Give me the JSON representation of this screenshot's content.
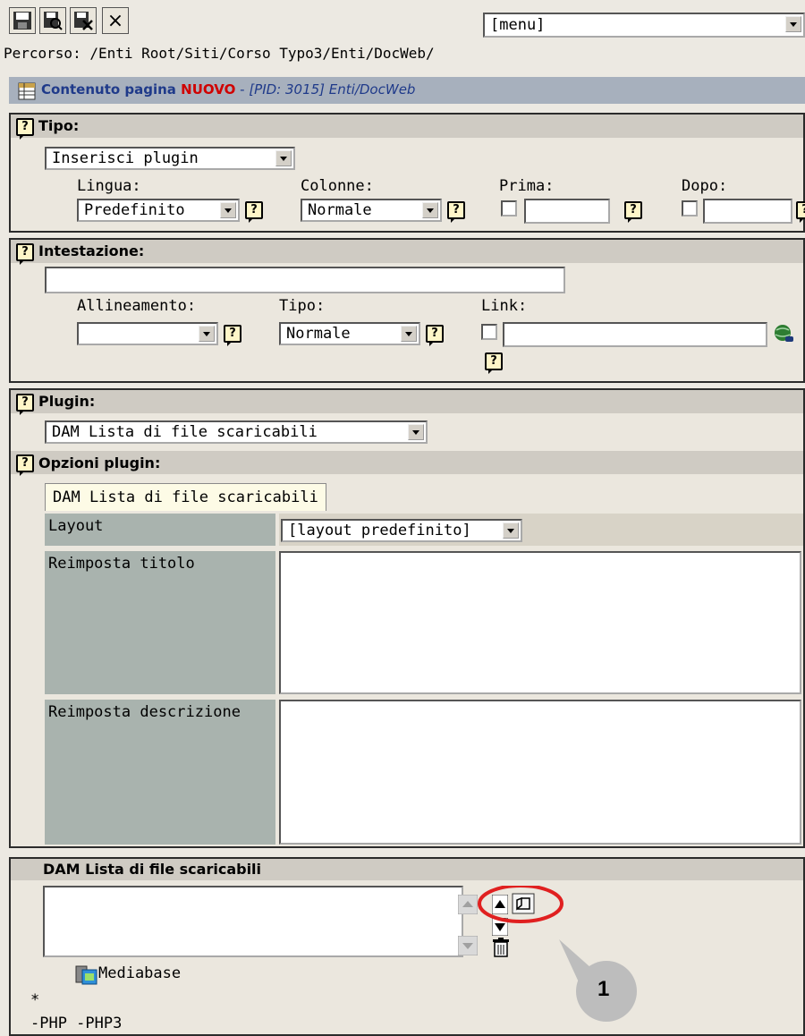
{
  "toolbar": {
    "save_icon": "save-disk-icon",
    "save_view_icon": "save-and-view-icon",
    "save_close_icon": "save-and-close-icon",
    "close_label": "×",
    "menu_value": "[menu]"
  },
  "path": "Percorso: /Enti Root/Siti/Corso Typo3/Enti/DocWeb/",
  "page_header": {
    "title": "Contenuto pagina",
    "status": "NUOVO",
    "separator": " - ",
    "pid": "[PID: 3015] Enti/DocWeb",
    "status_color": "#d00000",
    "title_color": "#1f3a8a"
  },
  "help_glyph": "?",
  "tipo": {
    "label": "Tipo:",
    "value": "Inserisci plugin",
    "lingua_label": "Lingua:",
    "lingua_value": "Predefinito",
    "colonne_label": "Colonne:",
    "colonne_value": "Normale",
    "prima_label": "Prima:",
    "dopo_label": "Dopo:"
  },
  "intestazione": {
    "label": "Intestazione:",
    "allineamento_label": "Allineamento:",
    "allineamento_value": "",
    "tipo_label": "Tipo:",
    "tipo_value": "Normale",
    "link_label": "Link:"
  },
  "plugin": {
    "label": "Plugin:",
    "value": "DAM Lista di file scaricabili",
    "options_label": "Opzioni plugin:",
    "tab_label": "DAM Lista di file scaricabili",
    "layout_label": "Layout",
    "layout_value": "[layout predefinito]",
    "titolo_label": "Reimposta titolo",
    "descrizione_label": "Reimposta descrizione"
  },
  "dam": {
    "label": "DAM Lista di file scaricabili",
    "mediabase_label": "Mediabase",
    "asterisk": "*",
    "extensions": "-PHP -PHP3"
  },
  "annotation": {
    "number": "1",
    "circle_color": "#e02020"
  }
}
